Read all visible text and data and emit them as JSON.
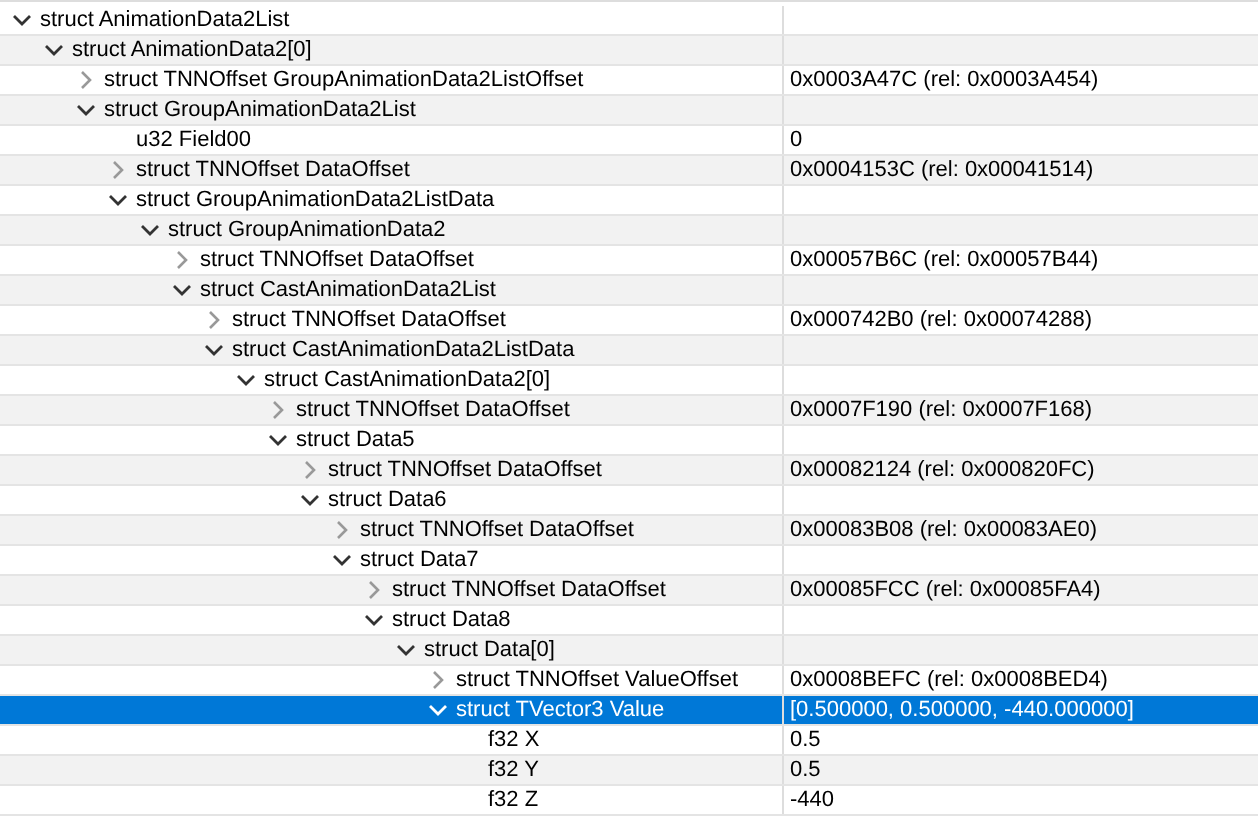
{
  "tree": [
    {
      "label": "struct AnimationData2List",
      "expanded": true,
      "selected": false,
      "children": [
        {
          "label": "struct AnimationData2[0]",
          "expanded": true,
          "selected": false,
          "children": [
            {
              "label": "struct TNNOffset GroupAnimationData2ListOffset",
              "value": "0x0003A47C (rel: 0x0003A454)",
              "expanded": false,
              "selected": false
            },
            {
              "label": "struct GroupAnimationData2List",
              "expanded": true,
              "selected": false,
              "children": [
                {
                  "label": "u32 Field00",
                  "value": "0",
                  "selected": false
                },
                {
                  "label": "struct TNNOffset DataOffset",
                  "value": "0x0004153C (rel: 0x00041514)",
                  "expanded": false,
                  "selected": false
                },
                {
                  "label": "struct GroupAnimationData2ListData",
                  "expanded": true,
                  "selected": false,
                  "children": [
                    {
                      "label": "struct GroupAnimationData2",
                      "expanded": true,
                      "selected": false,
                      "children": [
                        {
                          "label": "struct TNNOffset DataOffset",
                          "value": "0x00057B6C (rel: 0x00057B44)",
                          "expanded": false,
                          "selected": false
                        },
                        {
                          "label": "struct CastAnimationData2List",
                          "expanded": true,
                          "selected": false,
                          "children": [
                            {
                              "label": "struct TNNOffset DataOffset",
                              "value": "0x000742B0 (rel: 0x00074288)",
                              "expanded": false,
                              "selected": false
                            },
                            {
                              "label": "struct CastAnimationData2ListData",
                              "expanded": true,
                              "selected": false,
                              "children": [
                                {
                                  "label": "struct CastAnimationData2[0]",
                                  "expanded": true,
                                  "selected": false,
                                  "children": [
                                    {
                                      "label": "struct TNNOffset DataOffset",
                                      "value": "0x0007F190 (rel: 0x0007F168)",
                                      "expanded": false,
                                      "selected": false
                                    },
                                    {
                                      "label": "struct Data5",
                                      "expanded": true,
                                      "selected": false,
                                      "children": [
                                        {
                                          "label": "struct TNNOffset DataOffset",
                                          "value": "0x00082124 (rel: 0x000820FC)",
                                          "expanded": false,
                                          "selected": false
                                        },
                                        {
                                          "label": "struct Data6",
                                          "expanded": true,
                                          "selected": false,
                                          "children": [
                                            {
                                              "label": "struct TNNOffset DataOffset",
                                              "value": "0x00083B08 (rel: 0x00083AE0)",
                                              "expanded": false,
                                              "selected": false
                                            },
                                            {
                                              "label": "struct Data7",
                                              "expanded": true,
                                              "selected": false,
                                              "children": [
                                                {
                                                  "label": "struct TNNOffset DataOffset",
                                                  "value": "0x00085FCC (rel: 0x00085FA4)",
                                                  "expanded": false,
                                                  "selected": false
                                                },
                                                {
                                                  "label": "struct Data8",
                                                  "expanded": true,
                                                  "selected": false,
                                                  "children": [
                                                    {
                                                      "label": "struct Data[0]",
                                                      "expanded": true,
                                                      "selected": false,
                                                      "children": [
                                                        {
                                                          "label": "struct TNNOffset ValueOffset",
                                                          "value": "0x0008BEFC (rel: 0x0008BED4)",
                                                          "expanded": false,
                                                          "selected": false
                                                        },
                                                        {
                                                          "label": "struct TVector3 Value",
                                                          "value": "[0.500000, 0.500000, -440.000000]",
                                                          "expanded": true,
                                                          "selected": true,
                                                          "children": [
                                                            {
                                                              "label": "f32 X",
                                                              "value": "0.5",
                                                              "selected": false
                                                            },
                                                            {
                                                              "label": "f32 Y",
                                                              "value": "0.5",
                                                              "selected": false
                                                            },
                                                            {
                                                              "label": "f32 Z",
                                                              "value": "-440",
                                                              "selected": false
                                                            }
                                                          ]
                                                        }
                                                      ]
                                                    }
                                                  ]
                                                }
                                              ]
                                            }
                                          ]
                                        }
                                      ]
                                    }
                                  ]
                                }
                              ]
                            }
                          ]
                        }
                      ]
                    }
                  ]
                }
              ]
            }
          ]
        }
      ]
    }
  ]
}
